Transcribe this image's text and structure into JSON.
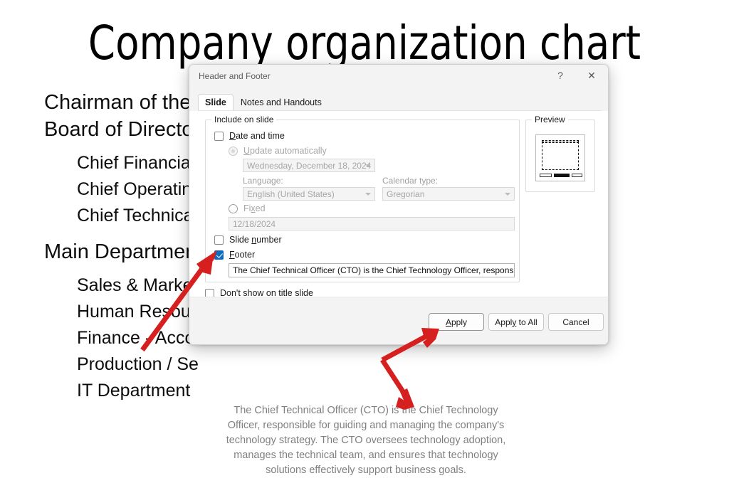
{
  "slide": {
    "title": "Company organization chart",
    "body_lines": [
      "Chairman of the",
      "Board of Directo"
    ],
    "sub_lines_1": [
      "Chief Financial",
      "Chief Operating",
      "Chief Technical"
    ],
    "body_line_2": "Main Departmen",
    "sub_lines_2": [
      "Sales & Marketi",
      "Human Resourc",
      "Finance - Accou",
      "Production / Se",
      "IT Department"
    ],
    "footer_text": "The Chief Technical Officer (CTO) is the Chief Technology Officer, responsible for guiding and managing the company's technology strategy. The CTO oversees technology adoption, manages the technical team, and ensures that technology solutions effectively support business goals."
  },
  "dialog": {
    "title": "Header and Footer",
    "help_icon": "?",
    "close_icon": "✕",
    "tabs": [
      {
        "label": "Slide",
        "active": true
      },
      {
        "label": "Notes and Handouts",
        "active": false
      }
    ],
    "include_group_label": "Include on slide",
    "date_and_time": {
      "label": "Date and time",
      "checked": false,
      "update_automatically": {
        "label": "Update automatically",
        "selected": false,
        "disabled": true,
        "value": "Wednesday, December 18, 2024"
      },
      "language": {
        "label": "Language:",
        "value": "English (United States)"
      },
      "calendar_type": {
        "label": "Calendar type:",
        "value": "Gregorian"
      },
      "fixed": {
        "label": "Fixed",
        "selected": false,
        "value": "12/18/2024"
      }
    },
    "slide_number": {
      "label": "Slide number",
      "checked": false
    },
    "footer": {
      "label": "Footer",
      "checked": true,
      "value": "The Chief Technical Officer (CTO) is the Chief Technology Officer, responsible f‹"
    },
    "dont_show_on_title_slide": {
      "label": "Don't show on title slide",
      "checked": false
    },
    "preview": {
      "label": "Preview"
    },
    "buttons": {
      "apply": "Apply",
      "apply_to_all": "Apply to All",
      "cancel": "Cancel"
    }
  },
  "annotations": {
    "arrow_color": "#d62020",
    "arrow_1_target": "footer-checkbox",
    "arrow_2_target_up": "apply-button",
    "arrow_2_target_down": "slide-footer-text"
  }
}
